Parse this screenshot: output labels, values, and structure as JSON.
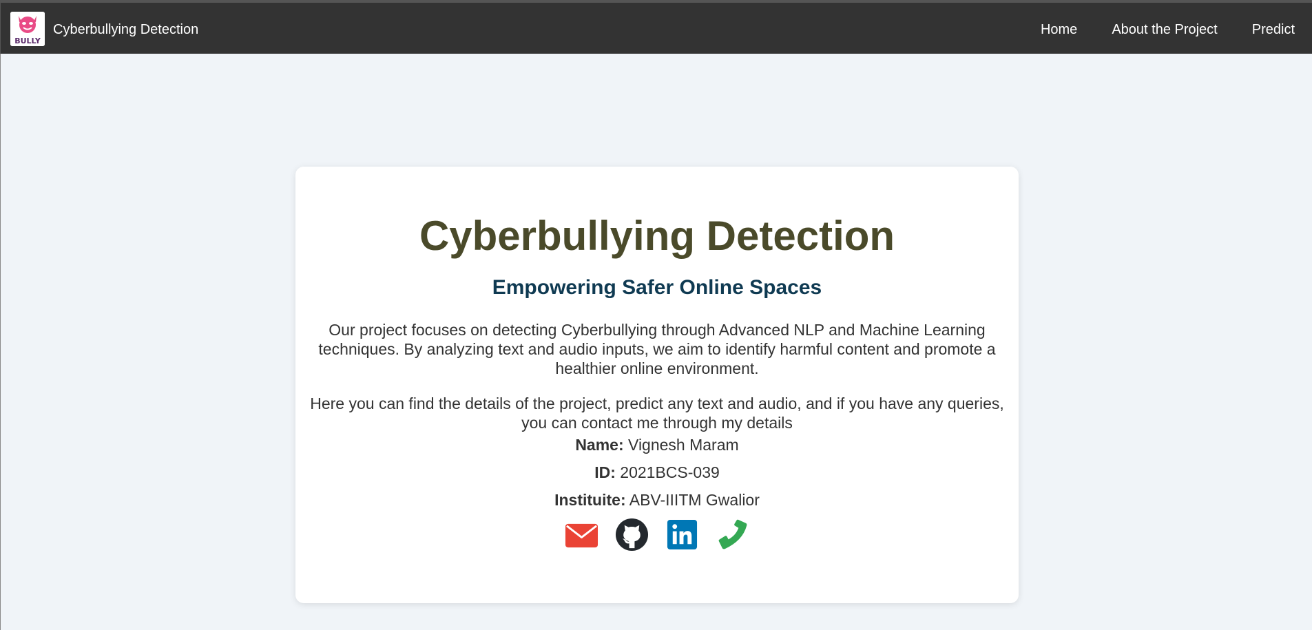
{
  "nav": {
    "brand": "Cyberbullying Detection",
    "logo_text": "BULLY",
    "links": [
      "Home",
      "About the Project",
      "Predict"
    ]
  },
  "hero": {
    "title": "Cyberbullying Detection",
    "subtitle": "Empowering Safer Online Spaces",
    "paragraph1": "Our project focuses on detecting Cyberbullying through Advanced NLP and Machine Learning techniques. By analyzing text and audio inputs, we aim to identify harmful content and promote a healthier online environment.",
    "paragraph2": "Here you can find the details of the project, predict any text and audio, and if you have any queries, you can contact me through my details"
  },
  "details": {
    "name_label": "Name:",
    "name_value": "Vignesh Maram",
    "id_label": "ID:",
    "id_value": "2021BCS-039",
    "institute_label": "Instituite:",
    "institute_value": "ABV-IIITM Gwalior"
  },
  "contacts": [
    {
      "icon": "envelope-icon",
      "color": "#ea4335"
    },
    {
      "icon": "github-icon",
      "color": "#24292e"
    },
    {
      "icon": "linkedin-icon",
      "color": "#0077b5"
    },
    {
      "icon": "phone-icon",
      "color": "#34a853"
    }
  ],
  "colors": {
    "navbar": "#333333",
    "background": "#f0f4f8",
    "title": "#4a4a2a",
    "subtitle": "#0f3a52"
  }
}
